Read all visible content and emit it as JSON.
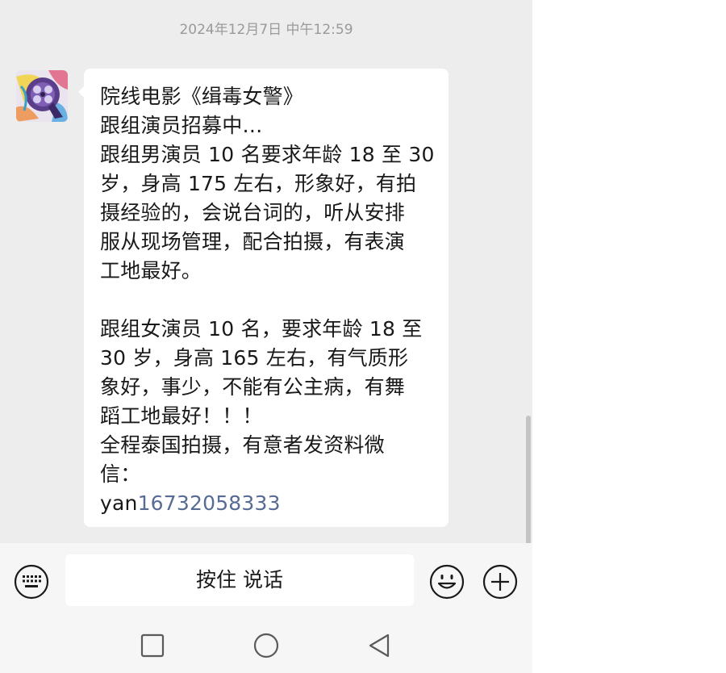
{
  "chat": {
    "timestamp": "2024年12月7日 中午12:59",
    "message": {
      "lines": [
        "院线电影《缉毒女警》",
        "跟组演员招募中…",
        "跟组男演员 10 名要求年龄 18 至 30",
        "岁，身高 175 左右，形象好，有拍",
        "摄经验的，会说台词的，听从安排",
        "服从现场管理，配合拍摄，有表演",
        "工地最好。",
        "",
        "跟组女演员 10 名，要求年龄 18 至",
        "30 岁，身高 165 左右，有气质形",
        "象好，事少，不能有公主病，有舞",
        "蹈工地最好！！！",
        "全程泰国拍摄，有意者发资料微",
        "信："
      ],
      "last_line_prefix": "yan",
      "phone_link": "16732058333"
    }
  },
  "input_bar": {
    "voice_button_label": "按住 说话",
    "icons": [
      "keyboard-icon",
      "emoji-icon",
      "plus-icon"
    ]
  },
  "nav": {
    "icons": [
      "recent-apps-icon",
      "home-icon",
      "back-icon"
    ]
  },
  "colors": {
    "chat_background": "#ededed",
    "bubble": "#ffffff",
    "link": "#576b95",
    "timestamp": "#9a9a9a"
  }
}
